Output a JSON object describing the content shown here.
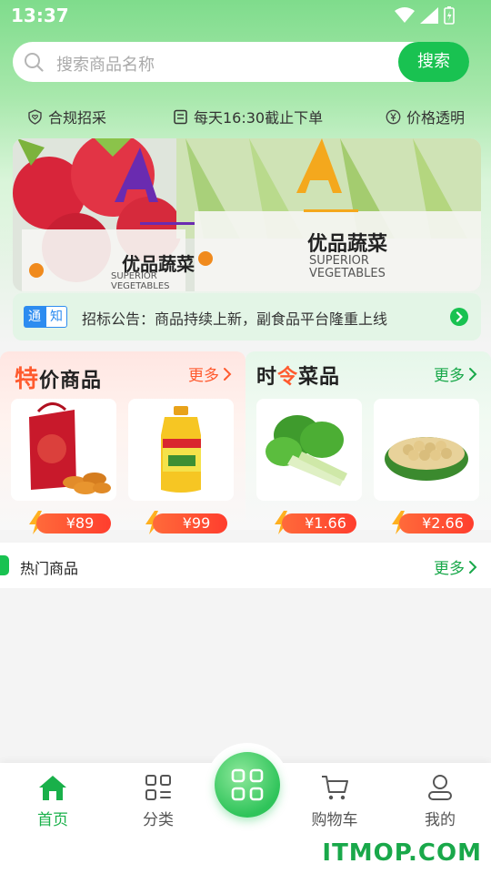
{
  "status_bar": {
    "time": "13:37"
  },
  "search": {
    "placeholder": "搜索商品名称",
    "button_label": "搜索"
  },
  "features": [
    {
      "icon": "shield-heart-icon",
      "label": "合规招采"
    },
    {
      "icon": "document-icon",
      "label": "每天16:30截止下单"
    },
    {
      "icon": "yen-circle-icon",
      "label": "价格透明"
    }
  ],
  "banner": {
    "labels": [
      "优品蔬菜",
      "优品蔬菜"
    ],
    "sub_labels": [
      "SUPERIOR VEGETABLES",
      "SUPERIOR VEGETABLES"
    ]
  },
  "notice": {
    "tag_left": "通",
    "tag_right": "知",
    "text": "招标公告：商品持续上新，副食品平台隆重上线"
  },
  "promo_left": {
    "title_first": "特",
    "title_rest": "价商品",
    "more_label": "更多",
    "products": [
      {
        "name": "mooncake-gift-box",
        "price": "¥89"
      },
      {
        "name": "cooking-oil",
        "price": "¥99"
      }
    ]
  },
  "promo_right": {
    "title_a": "时",
    "title_b": "令",
    "title_c": "菜品",
    "more_label": "更多",
    "products": [
      {
        "name": "bok-choy",
        "price": "¥1.66"
      },
      {
        "name": "soybeans",
        "price": "¥2.66"
      }
    ]
  },
  "hot": {
    "title": "热门商品",
    "more_label": "更多"
  },
  "tabbar": {
    "home": "首页",
    "category": "分类",
    "cart": "购物车",
    "mine": "我的"
  },
  "watermark": "ITMOP.COM",
  "colors": {
    "primary": "#19c251",
    "accent": "#ff5a2e",
    "notice_bg": "#e3f5e6"
  }
}
